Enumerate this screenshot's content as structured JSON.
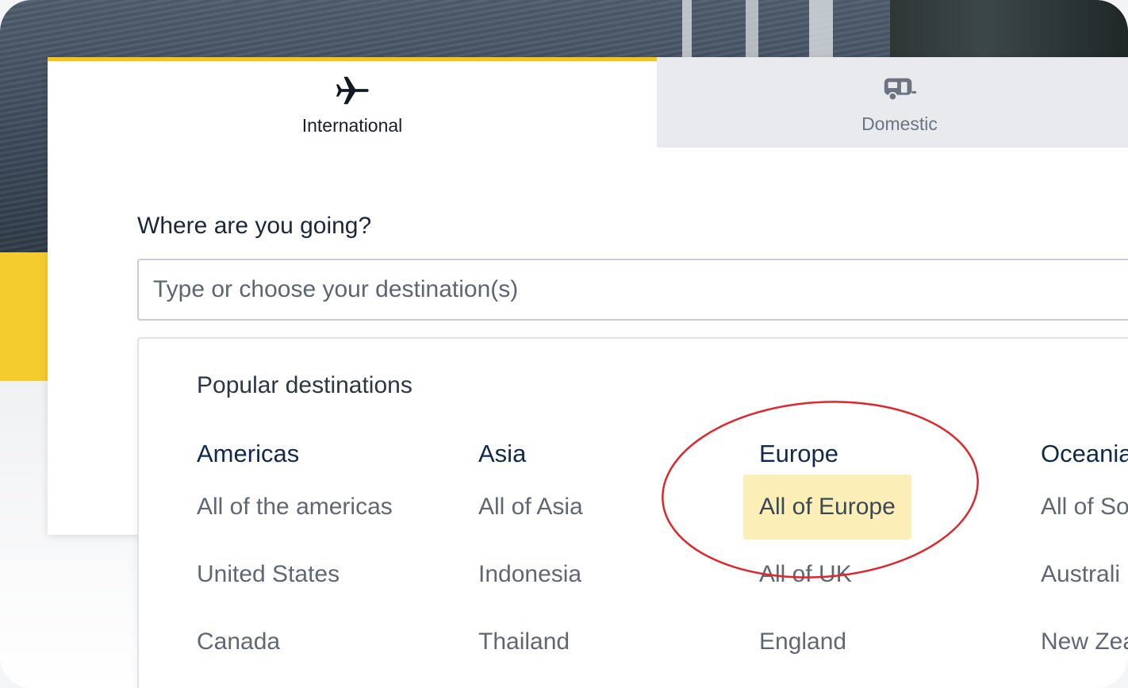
{
  "tabs": {
    "international": {
      "label": "International",
      "icon": "airplane-icon"
    },
    "domestic": {
      "label": "Domestic",
      "icon": "caravan-icon"
    }
  },
  "form": {
    "question": "Where are you going?",
    "destination_placeholder": "Type or choose your destination(s)"
  },
  "dropdown": {
    "title": "Popular destinations",
    "columns": [
      {
        "heading": "Americas",
        "items": [
          "All of the americas",
          "United States",
          "Canada"
        ]
      },
      {
        "heading": "Asia",
        "items": [
          "All of Asia",
          "Indonesia",
          "Thailand"
        ]
      },
      {
        "heading": "Europe",
        "items": [
          "All of Europe",
          "All of UK",
          "England"
        ]
      },
      {
        "heading": "Oceania",
        "items": [
          "All of So",
          "Australi",
          "New Zea"
        ]
      }
    ],
    "highlighted_item": "All of Europe"
  },
  "colors": {
    "accent_yellow": "#f5c518",
    "highlight": "#fbefb7",
    "heading_navy": "#0f2a4d",
    "annotation_red": "#e0262a"
  }
}
